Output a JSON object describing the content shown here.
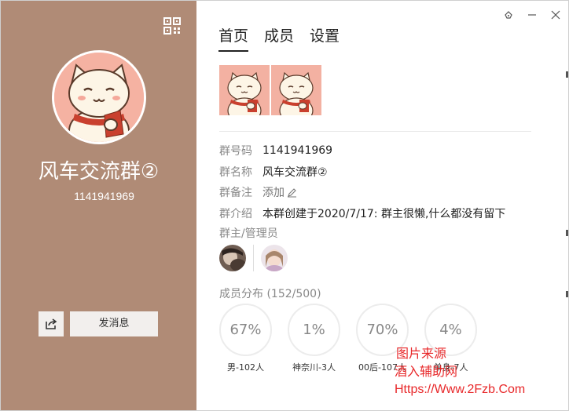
{
  "left": {
    "group_name": "风车交流群②",
    "group_id": "1141941969",
    "send_message_label": "发消息",
    "bg_color": "#b08b76"
  },
  "tabs": [
    {
      "label": "首页",
      "active": true
    },
    {
      "label": "成员",
      "active": false
    },
    {
      "label": "设置",
      "active": false
    }
  ],
  "info": {
    "rows": [
      {
        "label": "群号码",
        "value": "1141941969"
      },
      {
        "label": "群名称",
        "value": "风车交流群②"
      },
      {
        "label": "群备注",
        "value": "添加"
      },
      {
        "label": "群介绍",
        "value": "本群创建于2020/7/17:  群主很懒,什么都没有留下"
      }
    ]
  },
  "admins": {
    "label": "群主/管理员"
  },
  "distribution": {
    "label": "成员分布 (152/500)",
    "items": [
      {
        "percent": "67%",
        "caption": "男-102人"
      },
      {
        "percent": "1%",
        "caption": "神奈川-3人"
      },
      {
        "percent": "70%",
        "caption": "00后-107人"
      },
      {
        "percent": "4%",
        "caption": "单身-7人"
      }
    ]
  },
  "watermark": {
    "line1": "图片来源",
    "line2": "酒入辅助网",
    "line3": "Https://Www.2Fzb.Com",
    "color": "#e8282a"
  }
}
